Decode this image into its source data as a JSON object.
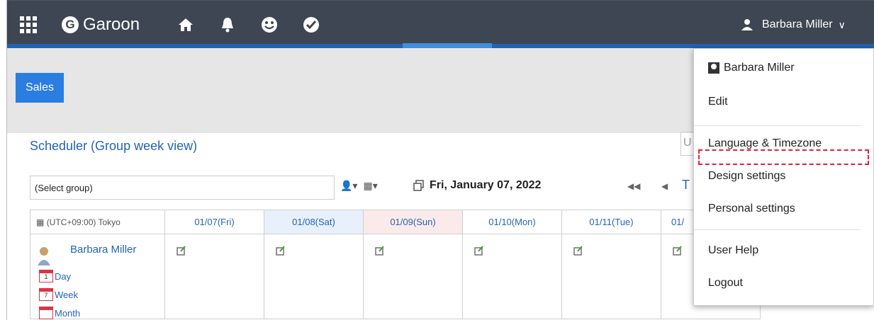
{
  "app": {
    "logo": "Garoon",
    "logo_letter": "G"
  },
  "header": {
    "user_name": "Barbara Miller",
    "icons": [
      "apps-grid-icon",
      "home-icon",
      "bell-icon",
      "smiley-icon",
      "check-circle-icon"
    ]
  },
  "group_tab": {
    "label": "Sales"
  },
  "scheduler": {
    "title": "Scheduler (Group week view)",
    "search_placeholder": "U",
    "group_select": "(Select group)",
    "date": "Fri, January 07, 2022",
    "today_label": "T",
    "timezone": "(UTC+09:00) Tokyo",
    "days": [
      "01/07(Fri)",
      "01/08(Sat)",
      "01/09(Sun)",
      "01/10(Mon)",
      "01/11(Tue)",
      "01/"
    ],
    "user": "Barbara Miller",
    "view_links": {
      "day": "Day",
      "day_num": "1",
      "week": "Week",
      "week_num": "7",
      "month": "Month"
    }
  },
  "user_menu": {
    "profile": "Barbara Miller",
    "edit": "Edit",
    "language": "Language & Timezone",
    "design": "Design settings",
    "personal": "Personal settings",
    "help": "User Help",
    "logout": "Logout"
  },
  "colors": {
    "topbar": "#3d4652",
    "accent": "#1e63b4",
    "link": "#2464b4",
    "highlight": "#e8203a"
  }
}
